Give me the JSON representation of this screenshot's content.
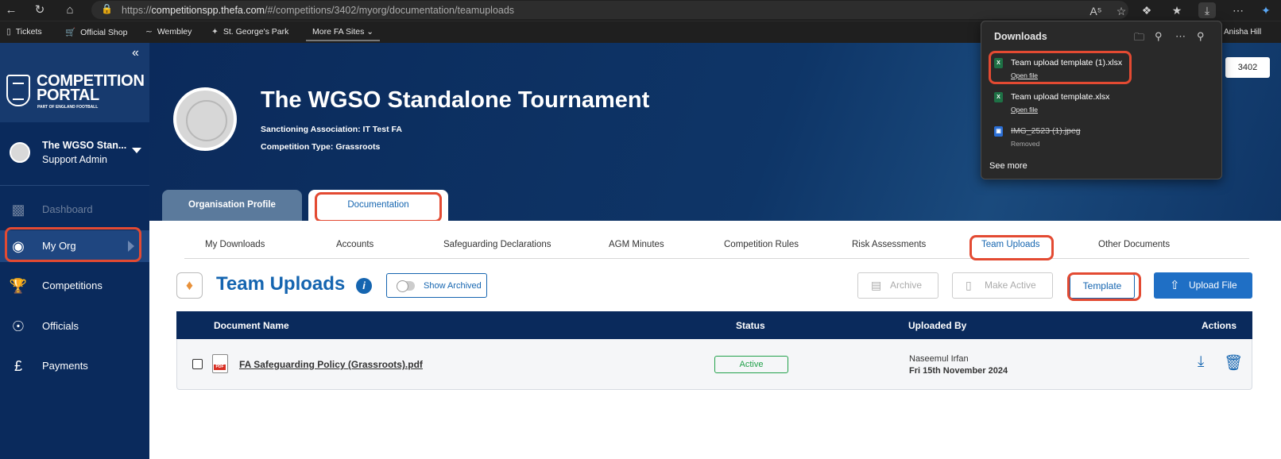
{
  "browser": {
    "url_prefix": "https://",
    "url_domain": "competitionspp.thefa.com",
    "url_path": "/#/competitions/3402/myorg/documentation/teamuploads",
    "favorites": [
      "Tickets",
      "Official Shop",
      "Wembley",
      "St. George's Park"
    ],
    "more_sites": "More FA Sites",
    "user_name": "Anisha Hill"
  },
  "downloads": {
    "title": "Downloads",
    "items": [
      {
        "name": "Team upload template (1).xlsx",
        "action": "Open file",
        "type": "xlsx"
      },
      {
        "name": "Team upload template.xlsx",
        "action": "Open file",
        "type": "xlsx"
      },
      {
        "name": "IMG_2523 (1).jpeg",
        "action": "Removed",
        "type": "jpeg"
      }
    ],
    "see_more": "See more"
  },
  "sidebar": {
    "logo_line1": "COMPETITION",
    "logo_line2": "PORTAL",
    "logo_sub": "PART OF ENGLAND FOOTBALL",
    "org_name": "The WGSO Stan...",
    "org_role": "Support Admin",
    "nav": [
      {
        "label": "Dashboard",
        "icon": "dashboard-icon"
      },
      {
        "label": "My Org",
        "icon": "org-badge-icon"
      },
      {
        "label": "Competitions",
        "icon": "trophy-icon"
      },
      {
        "label": "Officials",
        "icon": "officials-icon"
      },
      {
        "label": "Payments",
        "icon": "pound-icon"
      }
    ]
  },
  "banner": {
    "title": "The WGSO Standalone Tournament",
    "sanctioning_label": "Sanctioning Association:",
    "sanctioning_value": "IT Test FA",
    "type_label": "Competition Type:",
    "type_value": "Grassroots",
    "competition_id": "3402",
    "tabs": [
      "Organisation Profile",
      "Documentation"
    ]
  },
  "subtabs": [
    "My Downloads",
    "Accounts",
    "Safeguarding Declarations",
    "AGM Minutes",
    "Competition Rules",
    "Risk Assessments",
    "Team Uploads",
    "Other Documents"
  ],
  "page": {
    "heading": "Team Uploads",
    "show_archived": "Show Archived",
    "archive": "Archive",
    "make_active": "Make Active",
    "template": "Template",
    "upload_file": "Upload File"
  },
  "table": {
    "headers": [
      "Document Name",
      "Status",
      "Uploaded By",
      "Actions"
    ],
    "rows": [
      {
        "name": "FA Safeguarding Policy (Grassroots).pdf",
        "status": "Active",
        "uploaded_by": "Naseemul Irfan",
        "date": "Fri 15th November 2024"
      }
    ]
  },
  "colors": {
    "navy": "#0a2a5c",
    "accent_blue": "#1565b0",
    "highlight_red": "#e34a32",
    "active_green": "#22a14a"
  }
}
